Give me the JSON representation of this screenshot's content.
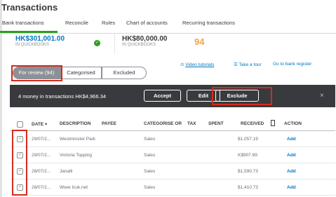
{
  "header": {
    "title": "Transactions"
  },
  "tabs": [
    {
      "label": "Bank transactions"
    },
    {
      "label": "Reconcile"
    },
    {
      "label": "Rules"
    },
    {
      "label": "Chart of accounts"
    },
    {
      "label": "Recurring transactions"
    }
  ],
  "accounts": [
    {
      "amount": "HK$301,001.00",
      "sub": "IN QUICKBOOKS"
    },
    {
      "amount": "HK$80,000.00",
      "sub": "IN QUICKBOOKS",
      "count": "94"
    }
  ],
  "filters": {
    "for_review": "For review (94)",
    "categorised": "Categorised",
    "excluded": "Excluded"
  },
  "links": {
    "video": "Video tutorials",
    "tour": "Take a tour",
    "register": "Go to bank register"
  },
  "batch": {
    "text": "4 money in transactions HK$4,966.34",
    "accept": "Accept",
    "edit": "Edit",
    "exclude": "Exclude",
    "close": "×"
  },
  "table": {
    "columns": [
      "DATE ▾",
      "DESCRIPTION",
      "PAYEE",
      "CATEGORISE OR",
      "TAX",
      "SPENT",
      "RECEIVED",
      "ACTION"
    ],
    "rows": [
      {
        "checked": true,
        "date": "29/07/2...",
        "description": "Westminster Park",
        "category": "Sales",
        "received": "$1,057.19",
        "action": "Add"
      },
      {
        "checked": true,
        "date": "29/07/2...",
        "description": "Victoria Topping",
        "category": "Sales",
        "received": "K$907.69",
        "action": "Add"
      },
      {
        "checked": true,
        "date": "28/07/2...",
        "description": "Janalli",
        "category": "Sales",
        "received": "$1,590.73",
        "action": "Add"
      },
      {
        "checked": true,
        "date": "28/07/2...",
        "description": "Www Icuk.net",
        "category": "Sales",
        "received": "$1,410.73",
        "action": "Add"
      }
    ]
  },
  "colors": {
    "green": "#2ca01c",
    "blue": "#0077c5",
    "dark": "#393a3d",
    "highlight": "#d52b1e"
  }
}
